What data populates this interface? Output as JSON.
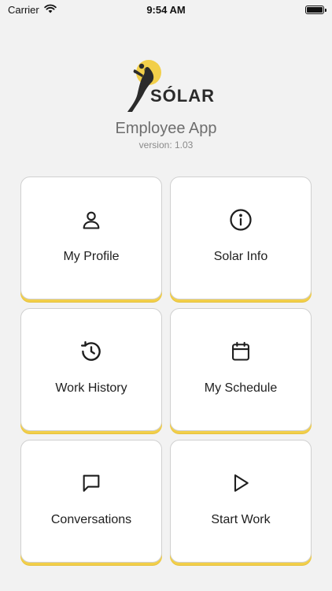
{
  "status_bar": {
    "carrier": "Carrier",
    "time": "9:54 AM"
  },
  "header": {
    "logo_text": "SÓLAR",
    "title": "Employee App",
    "version": "version: 1.03"
  },
  "colors": {
    "accent": "#f2cf4a",
    "background": "#f2f2f2",
    "tile": "#ffffff"
  },
  "menu": {
    "items": [
      {
        "label": "My Profile",
        "icon": "user-icon"
      },
      {
        "label": "Solar Info",
        "icon": "info-icon"
      },
      {
        "label": "Work History",
        "icon": "history-icon"
      },
      {
        "label": "My Schedule",
        "icon": "calendar-icon"
      },
      {
        "label": "Conversations",
        "icon": "chat-icon"
      },
      {
        "label": "Start Work",
        "icon": "play-icon"
      }
    ]
  }
}
